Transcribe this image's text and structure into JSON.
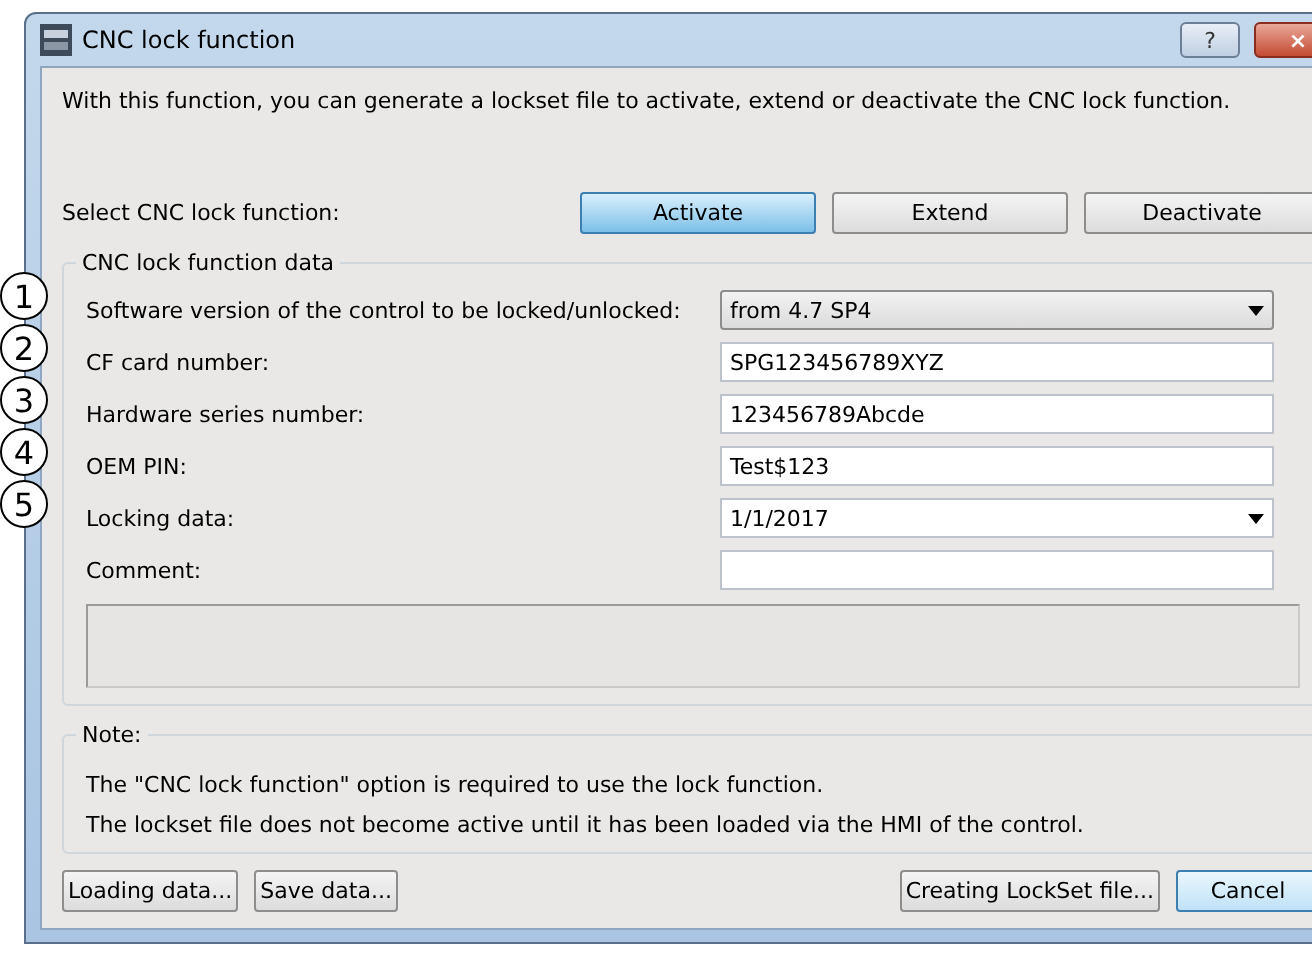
{
  "window": {
    "title": "CNC lock function",
    "help_button": "?",
    "close_button": "×"
  },
  "description": "With this function, you can generate a lockset file to activate, extend or deactivate the CNC lock function.",
  "function_select": {
    "label": "Select CNC lock function:",
    "options": [
      {
        "label": "Activate",
        "selected": true
      },
      {
        "label": "Extend",
        "selected": false
      },
      {
        "label": "Deactivate",
        "selected": false
      }
    ]
  },
  "data_group": {
    "title": "CNC lock function data",
    "rows": [
      {
        "callout": "1",
        "label": "Software version of the control to be locked/unlocked:",
        "kind": "combo",
        "value": "from 4.7 SP4"
      },
      {
        "callout": "2",
        "label": "CF card number:",
        "kind": "text",
        "value": "SPG123456789XYZ"
      },
      {
        "callout": "3",
        "label": "Hardware series number:",
        "kind": "text",
        "value": "123456789Abcde"
      },
      {
        "callout": "4",
        "label": "OEM PIN:",
        "kind": "text",
        "value": "Test$123"
      },
      {
        "callout": "5",
        "label": "Locking data:",
        "kind": "date",
        "value": "1/1/2017"
      },
      {
        "label": "Comment:",
        "kind": "text"
      }
    ]
  },
  "note": {
    "title": "Note:",
    "lines": [
      "The \"CNC lock function\" option is required to use the lock function.",
      "The lockset file does not become active until it has been loaded via the HMI of the control."
    ]
  },
  "buttons_left": [
    {
      "label": "Loading data...",
      "default": false
    },
    {
      "label": "Save data...",
      "default": false
    }
  ],
  "buttons_right": [
    {
      "label": "Creating LockSet file...",
      "default": false
    },
    {
      "label": "Cancel",
      "default": true
    }
  ]
}
